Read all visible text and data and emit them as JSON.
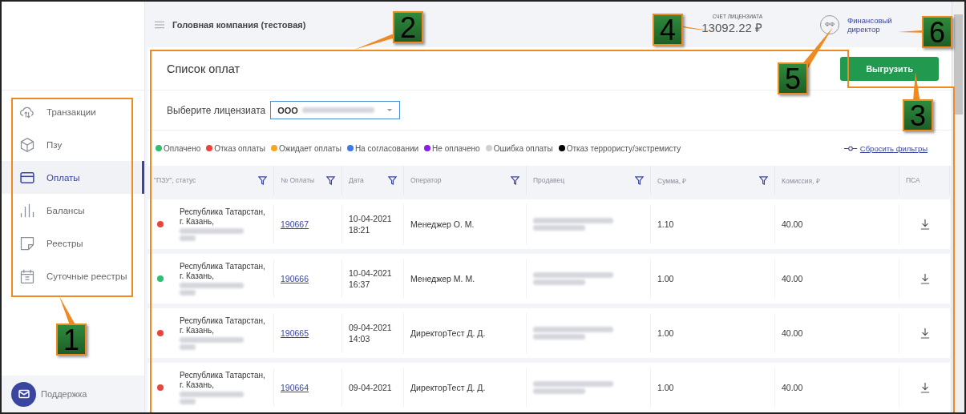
{
  "header": {
    "company": "Головная компания (тестовая)",
    "account_label": "СЧЕТ ЛИЦЕНЗИАТА",
    "balance": "13092.22 ₽",
    "avatar": "ФФ",
    "user": "Финансовый директор"
  },
  "sidebar": {
    "items": [
      {
        "label": "Транзакции",
        "kind": "cloud",
        "selected": false
      },
      {
        "label": "Пзу",
        "kind": "box",
        "selected": false
      },
      {
        "label": "Оплаты",
        "kind": "card",
        "selected": true
      },
      {
        "label": "Балансы",
        "kind": "bars",
        "selected": false
      },
      {
        "label": "Реестры",
        "kind": "note",
        "selected": false
      },
      {
        "label": "Суточные реестры",
        "kind": "calendar",
        "selected": false
      }
    ],
    "support": "Поддержка"
  },
  "page": {
    "title": "Список оплат",
    "export_button": "Выгрузить",
    "licensee_label": "Выберите лицензиата",
    "licensee_value": "ООО",
    "reset_filters": "Сбросить фильтры"
  },
  "legend": [
    {
      "label": "Оплачено",
      "color": "#2fbf71"
    },
    {
      "label": "Отказ оплаты",
      "color": "#e8453c"
    },
    {
      "label": "Ожидает оплаты",
      "color": "#f5a623"
    },
    {
      "label": "На согласовании",
      "color": "#3d7be8"
    },
    {
      "label": "Не оплачено",
      "color": "#8a1ee8"
    },
    {
      "label": "Ошибка оплаты",
      "color": "#d0d0d4"
    },
    {
      "label": "Отказ террористу/экстремисту",
      "color": "#000000"
    }
  ],
  "table": {
    "columns": [
      {
        "label": "\"ПЗУ\", статус",
        "filter": true
      },
      {
        "label": "№ Оплаты",
        "filter": true
      },
      {
        "label": "Дата",
        "filter": true
      },
      {
        "label": "Оператор",
        "filter": true
      },
      {
        "label": "Продавец",
        "filter": true
      },
      {
        "label": "Сумма, ₽",
        "filter": true
      },
      {
        "label": "Комиссия, ₽",
        "filter": false
      },
      {
        "label": "ПСА",
        "filter": false
      }
    ],
    "rows": [
      {
        "color": "#e8453c",
        "address": "Республика Татарстан, г. Казань,",
        "payment_no": "190667",
        "date": "10-04-2021",
        "time": "18:21",
        "operator": "Менеджер О. М.",
        "amount": "1.10",
        "commission": "40.00"
      },
      {
        "color": "#2fbf71",
        "address": "Республика Татарстан, г. Казань,",
        "payment_no": "190666",
        "date": "10-04-2021",
        "time": "16:37",
        "operator": "Менеджер М. М.",
        "amount": "1.00",
        "commission": "40.00"
      },
      {
        "color": "#e8453c",
        "address": "Республика Татарстан, г. Казань,",
        "payment_no": "190665",
        "date": "09-04-2021",
        "time": "14:03",
        "operator": "ДиректорТест Д. Д.",
        "amount": "1.00",
        "commission": "40.00"
      },
      {
        "color": "#e8453c",
        "address": "Республика Татарстан, г. Казань,",
        "payment_no": "190664",
        "date": "09-04-2021",
        "operator": "ДиректорТест Д. Д.",
        "amount": "1.00",
        "commission": "40.00"
      }
    ]
  },
  "annotations": [
    {
      "number": "1"
    },
    {
      "number": "2"
    },
    {
      "number": "3"
    },
    {
      "number": "4"
    },
    {
      "number": "5"
    },
    {
      "number": "6"
    }
  ]
}
